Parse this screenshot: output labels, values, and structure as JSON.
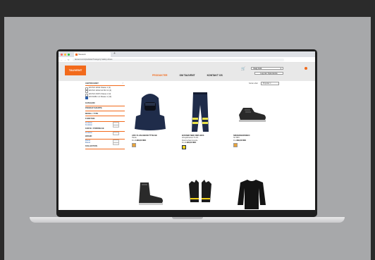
{
  "browser": {
    "tab_title": "Tauvent",
    "url": "tauvent.com/produkter?category=safety-shoes",
    "nav_back": "←",
    "nav_forward": "→",
    "nav_reload": "↻",
    "new_tab": "+"
  },
  "site": {
    "logo_text": "TAUVENT",
    "nav": [
      {
        "label": "PRODUKTER",
        "active": true
      },
      {
        "label": "OM TAUVENT",
        "active": false
      },
      {
        "label": "KONTAKT OS",
        "active": false
      }
    ],
    "cart_icon": "🛒",
    "account_select": "Vælg butik",
    "login_button": "Log ind / Opret konto"
  },
  "filters": {
    "heading": "CERTIFICERET",
    "options": [
      {
        "label": "EN ISO 11611 Klasse 1 (2)",
        "checked": false
      },
      {
        "label": "EN ISO 11612 A1 B1 C1 (4)",
        "checked": false
      },
      {
        "label": "EN ISO 20471 Klasse 2 (3)",
        "checked": false
      },
      {
        "label": "EN 61482-1-2 Klasse 1 (12)",
        "checked": true
      }
    ],
    "categories": [
      "KATEGORI",
      "PRODUKTGRUPPE",
      "MODEL / TYPE",
      "FUNKTION"
    ],
    "function_sub": [
      "Funktion",
      "Funktion"
    ],
    "more_categories": [
      "FARVE / STØRRELSE",
      "BRAND"
    ],
    "brand_sub": [
      "Brand",
      "Brand"
    ],
    "last_category": "KOLLEKTION"
  },
  "sort": {
    "label": "Sorter efter",
    "value": "Populær"
  },
  "products": [
    {
      "title": "ARC FLASH BESKYTTELSE",
      "desc": "Hætte",
      "price_label": "Fra",
      "price": "1.499,00 DKK",
      "swatch": "#e8a33a"
    },
    {
      "title": "BUKSER MED REFLEKS",
      "desc": "Arbejdsbukser Hi-Vis",
      "desc2": "Flammehæmmende",
      "price_label": "Fra",
      "price": "1.199,00 DKK",
      "swatch": "#f2d21b"
    },
    {
      "title": "SIKKERHEDSSKO",
      "desc": "S3 SRC",
      "price_label": "Fra",
      "price": "899,00 DKK",
      "swatch": "#e8a33a"
    }
  ],
  "second_row": [
    "safety-boot",
    "gloves",
    "base-layer"
  ]
}
